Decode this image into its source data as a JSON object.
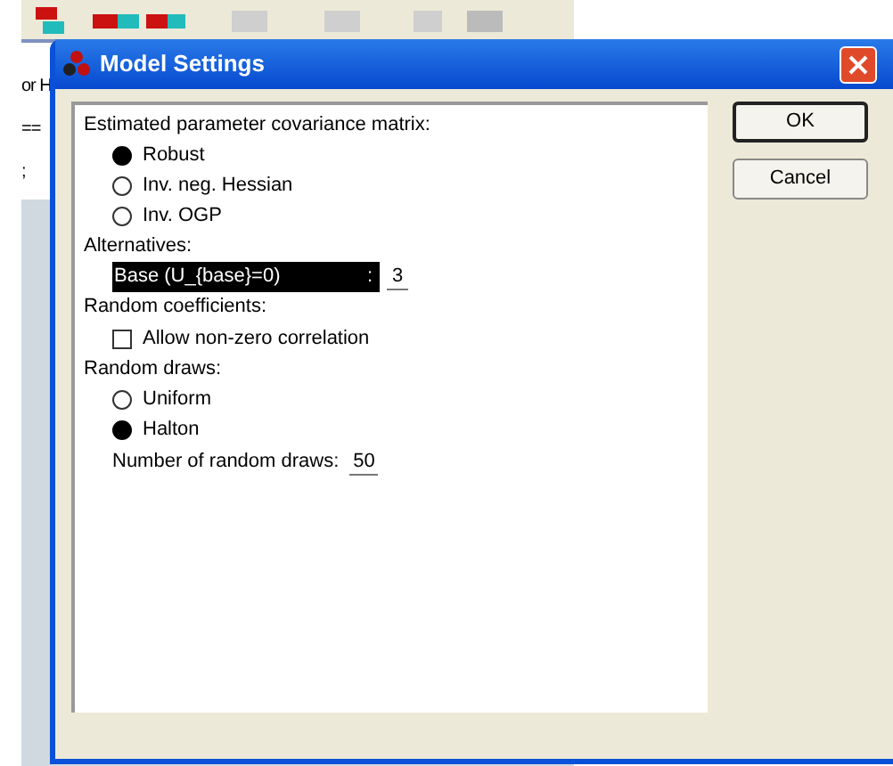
{
  "background_window": {
    "texts": [
      "or H",
      "==",
      ";"
    ]
  },
  "dialog": {
    "title": "Model Settings",
    "sections": [
      {
        "kind": "radio",
        "label": "Estimated parameter covariance matrix:",
        "options": [
          {
            "label": "Robust",
            "selected": true
          },
          {
            "label": "Inv. neg. Hessian",
            "selected": false
          },
          {
            "label": "Inv. OGP",
            "selected": false
          }
        ]
      },
      {
        "kind": "list",
        "label": "Alternatives:",
        "items": [
          {
            "name": "Base (U_{base}=0)",
            "separator": ":",
            "value": "3",
            "selected": true
          }
        ]
      },
      {
        "kind": "checkbox",
        "label": "Random coefficients:",
        "options": [
          {
            "label": "Allow non-zero correlation",
            "checked": false
          }
        ]
      },
      {
        "kind": "radio",
        "label": "Random draws:",
        "options": [
          {
            "label": "Uniform",
            "selected": false
          },
          {
            "label": "Halton",
            "selected": true
          }
        ],
        "field": {
          "label": "Number of random draws:",
          "value": "50"
        }
      }
    ],
    "buttons": [
      "OK",
      "Cancel"
    ]
  }
}
